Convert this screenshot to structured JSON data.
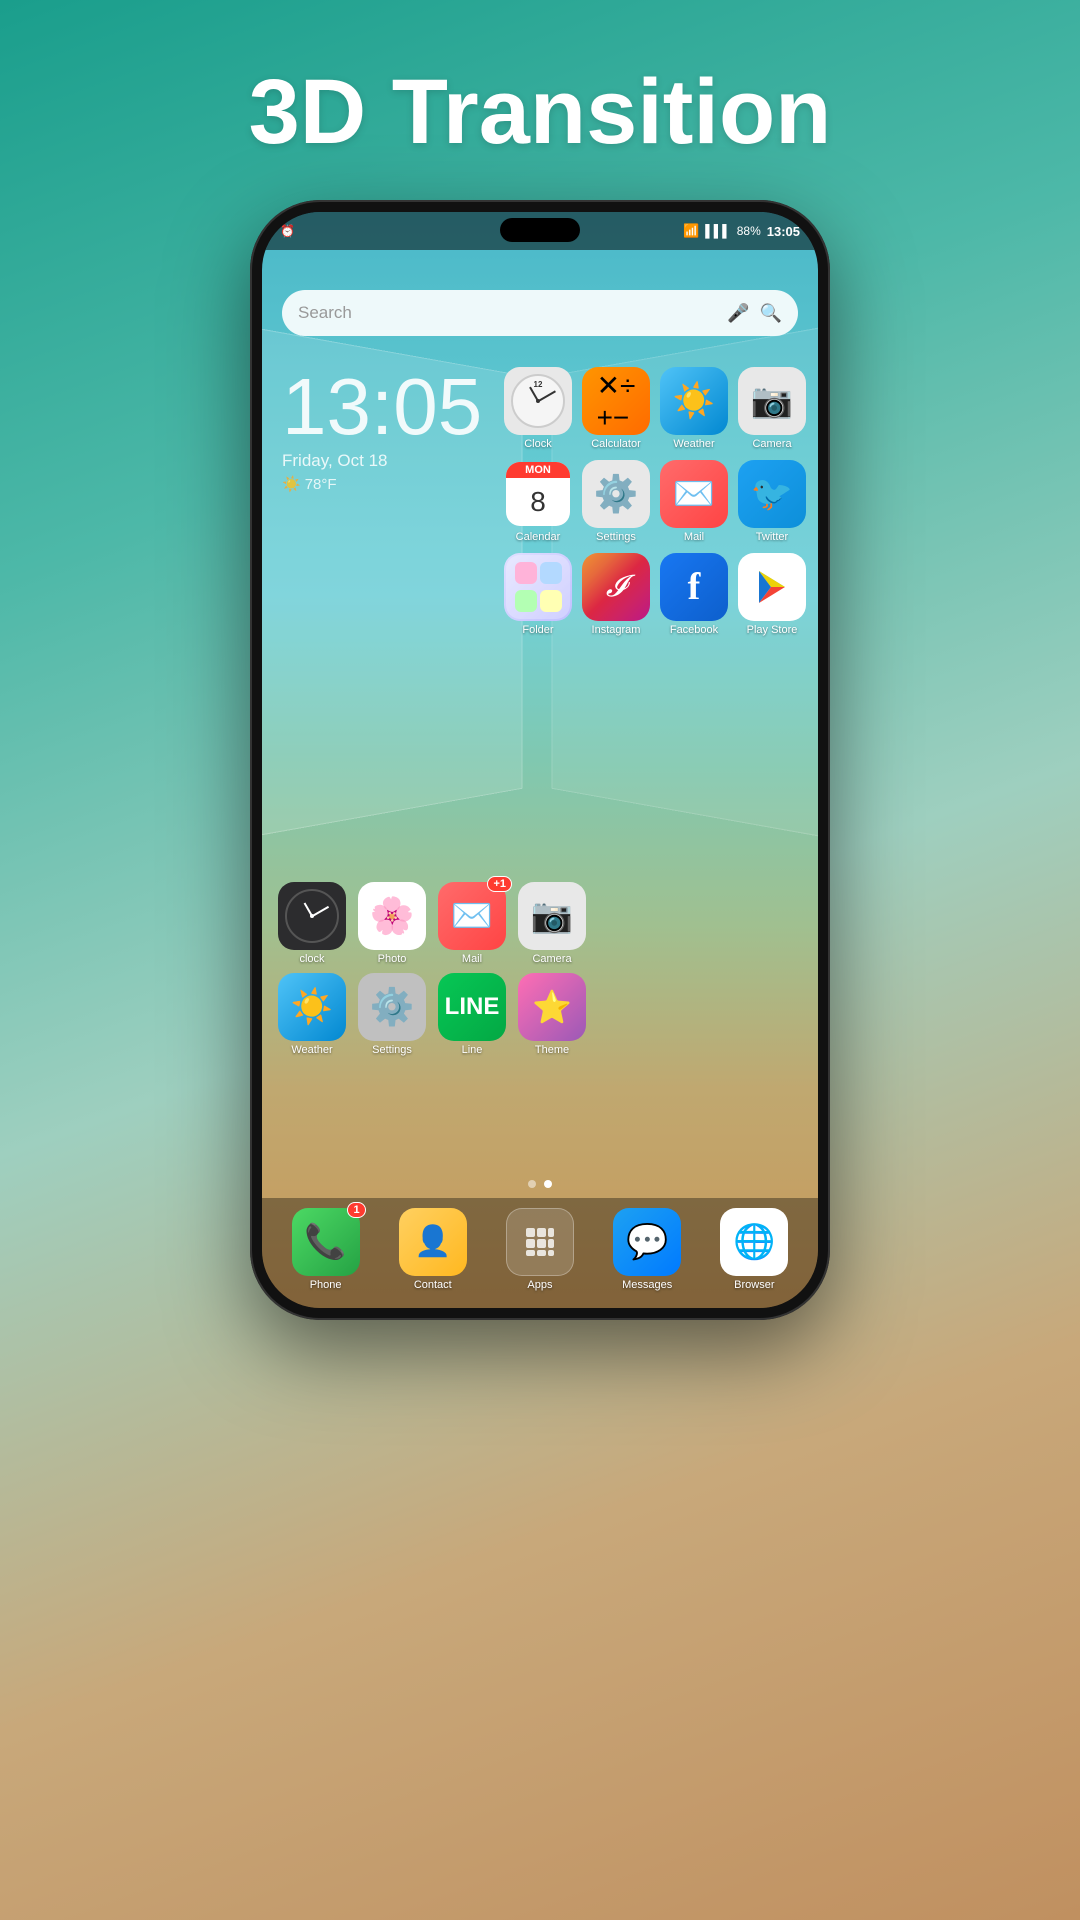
{
  "title": "3D Transition",
  "status": {
    "time": "13:05",
    "battery": "88%",
    "signal": "WiFi",
    "left_icon": "⏰"
  },
  "search": {
    "placeholder": "Search"
  },
  "clock_widget": {
    "time": "13:05",
    "date": "Friday, Oct 18",
    "weather": "78°F"
  },
  "apps_right": [
    {
      "id": "clock",
      "label": "Clock",
      "icon_type": "clock",
      "bg": "bg-clock"
    },
    {
      "id": "calculator",
      "label": "Calculator",
      "icon": "±",
      "bg": "bg-calc",
      "emoji": "🔢"
    },
    {
      "id": "weather",
      "label": "Weather",
      "icon": "☀️",
      "bg": "bg-weather"
    },
    {
      "id": "camera-r",
      "label": "Camera",
      "icon": "📷",
      "bg": "bg-camera"
    },
    {
      "id": "calendar",
      "label": "Calendar",
      "icon_type": "calendar",
      "day": "MON",
      "num": "8",
      "bg": "bg-calendar"
    },
    {
      "id": "settings-r",
      "label": "Settings",
      "icon": "⚙️",
      "bg": "bg-settings"
    },
    {
      "id": "mail-r",
      "label": "Mail",
      "icon": "✉️",
      "bg": "bg-mail"
    },
    {
      "id": "twitter",
      "label": "Twitter",
      "icon": "🐦",
      "bg": "bg-twitter"
    },
    {
      "id": "folder",
      "label": "Folder",
      "icon_type": "folder",
      "bg": "bg-folder"
    },
    {
      "id": "instagram",
      "label": "Instagram",
      "icon": "📸",
      "bg": "bg-instagram"
    },
    {
      "id": "facebook",
      "label": "Facebook",
      "icon": "f",
      "bg": "bg-facebook"
    },
    {
      "id": "playstore",
      "label": "Play Store",
      "icon": "▶",
      "bg": "bg-playstore"
    }
  ],
  "apps_left_row1": [
    {
      "id": "clock-l",
      "label": "clock",
      "icon_type": "clock-dark",
      "bg": "bg-dark-clock"
    },
    {
      "id": "photo",
      "label": "Photo",
      "icon": "🌸",
      "bg": "bg-photo"
    },
    {
      "id": "mail-l",
      "label": "Mail",
      "icon": "✉️",
      "bg": "bg-mail",
      "badge": "+1"
    },
    {
      "id": "camera-l",
      "label": "Camera",
      "icon": "📷",
      "bg": "bg-camera"
    }
  ],
  "apps_left_row2": [
    {
      "id": "weather-l",
      "label": "Weather",
      "icon": "☀️",
      "bg": "bg-weather"
    },
    {
      "id": "settings-l",
      "label": "Settings",
      "icon": "⚙️",
      "bg": "bg-dark-settings"
    },
    {
      "id": "line",
      "label": "Line",
      "icon": "💬",
      "bg": "bg-line"
    },
    {
      "id": "theme",
      "label": "Theme",
      "icon": "🌟",
      "bg": "bg-theme"
    }
  ],
  "dock": [
    {
      "id": "phone",
      "label": "Phone",
      "icon": "📞",
      "bg": "bg-phone",
      "badge": "1"
    },
    {
      "id": "contact",
      "label": "Contact",
      "icon": "👤",
      "bg": "bg-contact"
    },
    {
      "id": "apps",
      "label": "Apps",
      "icon": "⋮⋮⋮",
      "bg": "bg-apps"
    },
    {
      "id": "messages",
      "label": "Messages",
      "icon": "💬",
      "bg": "bg-messages"
    },
    {
      "id": "browser",
      "label": "Browser",
      "icon": "🌐",
      "bg": "bg-browser"
    }
  ],
  "page_dots": [
    {
      "active": false
    },
    {
      "active": true
    }
  ]
}
